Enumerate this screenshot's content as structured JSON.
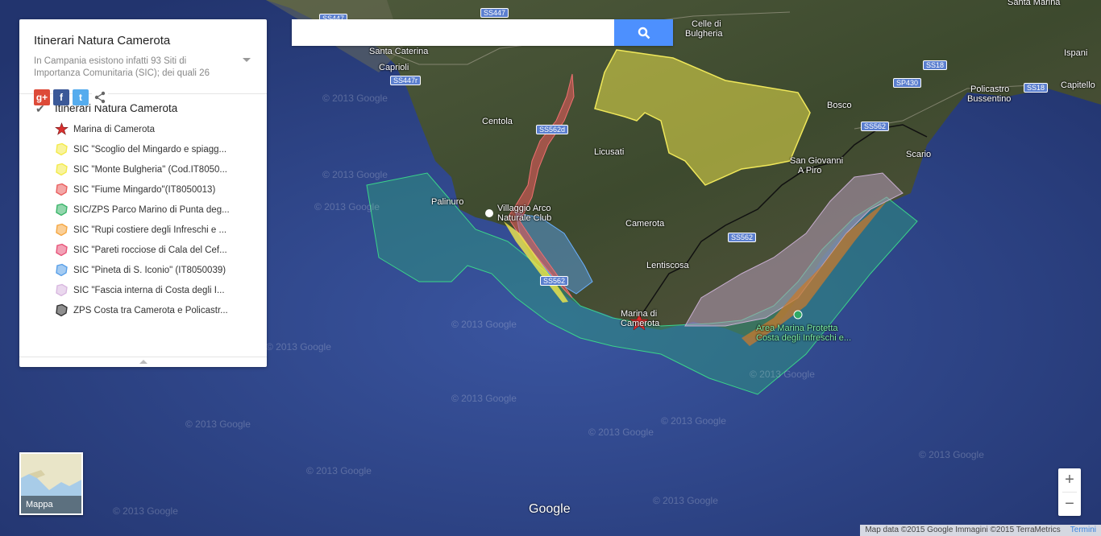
{
  "panel": {
    "title": "Itinerari Natura Camerota",
    "description": "In Campania esistono infatti 93 Siti di Importanza Comunitaria (SIC); dei quali 26",
    "share": {
      "gplus": "g+",
      "facebook": "f",
      "twitter": "t"
    },
    "layer_title": "Itinerari Natura Camerota",
    "layer_checked": true,
    "items": [
      {
        "label": "Marina di Camerota",
        "color": "#d9302f",
        "type": "star"
      },
      {
        "label": "SIC \"Scoglio del Mingardo e spiagg...",
        "color": "#f3ea4a",
        "type": "poly"
      },
      {
        "label": "SIC \"Monte Bulgheria\" (Cod.IT8050...",
        "color": "#f3ea4a",
        "type": "poly"
      },
      {
        "label": "SIC \"Fiume Mingardo\"(IT8050013)",
        "color": "#ea5f5f",
        "type": "poly"
      },
      {
        "label": "SIC/ZPS Parco Marino di Punta deg...",
        "color": "#3bb56a",
        "type": "poly"
      },
      {
        "label": "SIC \"Rupi costiere degli Infreschi e ...",
        "color": "#f5a742",
        "type": "poly"
      },
      {
        "label": "SIC \"Pareti rocciose di Cala del Cef...",
        "color": "#e8557a",
        "type": "poly"
      },
      {
        "label": "SIC \"Pineta di S. Iconio\" (IT8050039)",
        "color": "#5aa0e8",
        "type": "poly"
      },
      {
        "label": "SIC \"Fascia interna di Costa degli I...",
        "color": "#d9b8e0",
        "type": "poly"
      },
      {
        "label": "ZPS Costa tra Camerota e Policastr...",
        "color": "#333333",
        "type": "poly"
      }
    ]
  },
  "search": {
    "placeholder": "",
    "value": ""
  },
  "map": {
    "mode_label": "Mappa",
    "logo": "Google",
    "attribution": "Map data ©2015 Google Immagini ©2015 TerraMetrics",
    "terms": "Termini",
    "zoom_in": "+",
    "zoom_out": "−",
    "watermark": "© 2013 Google",
    "places": [
      {
        "name": "Santa Caterina"
      },
      {
        "name": "Caprioli"
      },
      {
        "name": "Centola"
      },
      {
        "name": "Celle di"
      },
      {
        "name": "Bulgheria"
      },
      {
        "name": "Licusati"
      },
      {
        "name": "Palinuro"
      },
      {
        "name": "Villaggio Arco"
      },
      {
        "name": "Naturale Club"
      },
      {
        "name": "Camerota"
      },
      {
        "name": "Lentiscosa"
      },
      {
        "name": "Marina di"
      },
      {
        "name": "Camerota"
      },
      {
        "name": "San Giovanni"
      },
      {
        "name": "A Piro"
      },
      {
        "name": "Bosco"
      },
      {
        "name": "Policastro"
      },
      {
        "name": "Bussentino"
      },
      {
        "name": "Scario"
      },
      {
        "name": "Ispani"
      },
      {
        "name": "Capitello"
      },
      {
        "name": "Santa Marina"
      },
      {
        "name": "Area Marina Protetta"
      },
      {
        "name": "Costa degli Infreschi e..."
      }
    ],
    "roads": [
      "SS447",
      "SS447",
      "SS447r",
      "SS562d",
      "SS562",
      "SS562",
      "SS18",
      "SS18",
      "SP430",
      "SS562"
    ]
  }
}
